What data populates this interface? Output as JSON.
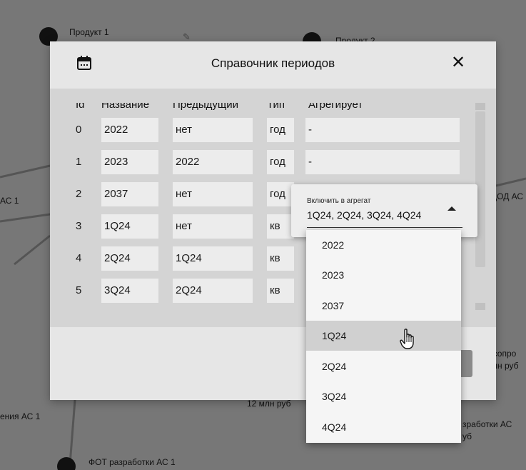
{
  "background": {
    "labels": {
      "product1": "Продукт 1",
      "product2": "Продукт 2",
      "left_mid": "АС 1",
      "right_mid": "ДОД АС",
      "left_bottom": "ения АС 1",
      "center_bottom": "12 млн руб",
      "right_bottom_1": "Т сопро",
      "right_bottom_2": "лн руб",
      "right_low_1": "зработки АС",
      "right_low_2": "уб",
      "bottom": "ФОТ разработки АС 1"
    }
  },
  "dialog": {
    "title": "Справочник периодов",
    "close_icon": "close-icon",
    "calendar_icon": "calendar-icon",
    "columns": [
      "Id",
      "Название",
      "Предыдущий",
      "Тип",
      "Агрегирует"
    ],
    "rows": [
      {
        "id": "0",
        "name": "2022",
        "prev": "нет",
        "type": "год",
        "agg": "-"
      },
      {
        "id": "1",
        "name": "2023",
        "prev": "2022",
        "type": "год",
        "agg": "-"
      },
      {
        "id": "2",
        "name": "2037",
        "prev": "нет",
        "type": "год",
        "agg": ""
      },
      {
        "id": "3",
        "name": "1Q24",
        "prev": "нет",
        "type": "кв",
        "agg": ""
      },
      {
        "id": "4",
        "name": "2Q24",
        "prev": "1Q24",
        "type": "кв",
        "agg": ""
      },
      {
        "id": "5",
        "name": "3Q24",
        "prev": "2Q24",
        "type": "кв",
        "agg": ""
      }
    ]
  },
  "aggregate_select": {
    "label": "Включить в агрегат",
    "value": "1Q24, 2Q24, 3Q24, 4Q24",
    "options": [
      "2022",
      "2023",
      "2037",
      "1Q24",
      "2Q24",
      "3Q24",
      "4Q24"
    ],
    "hovered_option": "1Q24"
  }
}
